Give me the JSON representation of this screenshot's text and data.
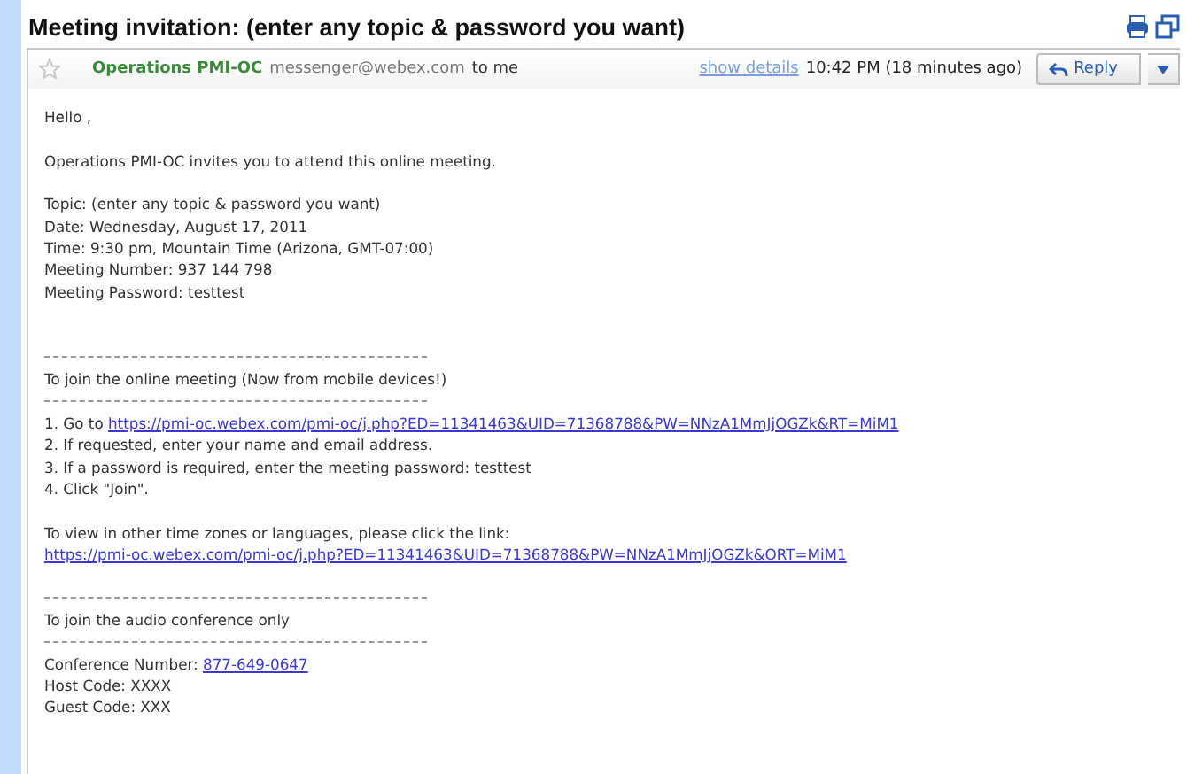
{
  "subject": "Meeting invitation: (enter any topic & password you want)",
  "header": {
    "starred": false,
    "sender": "Operations PMI-OC",
    "address": "messenger@webex.com",
    "to": "to me",
    "details_link": "show details",
    "time": "10:42 PM (18 minutes ago)",
    "reply": "Reply"
  },
  "body": [
    {
      "kind": "text",
      "text": "Hello ,"
    },
    {
      "kind": "blank"
    },
    {
      "kind": "text",
      "text": "Operations PMI-OC invites you to attend this online meeting."
    },
    {
      "kind": "blank"
    },
    {
      "kind": "text",
      "text": "Topic: (enter any topic & password you want)"
    },
    {
      "kind": "text",
      "text": "Date: Wednesday, August 17, 2011"
    },
    {
      "kind": "text",
      "text": "Time: 9:30 pm, Mountain Time (Arizona, GMT-07:00)"
    },
    {
      "kind": "text",
      "text": "Meeting Number: 937 144 798"
    },
    {
      "kind": "text",
      "text": "Meeting Password: testtest"
    },
    {
      "kind": "blank"
    },
    {
      "kind": "blank"
    },
    {
      "kind": "rule"
    },
    {
      "kind": "text",
      "text": "To join the online meeting (Now from mobile devices!)"
    },
    {
      "kind": "rule"
    },
    {
      "kind": "link",
      "text": "1. Go to ",
      "link": "https://pmi-oc.webex.com/pmi-oc/j.php?ED=11341463&UID=71368788&PW=NNzA1MmJjOGZk&RT=MiM1"
    },
    {
      "kind": "text",
      "text": "2. If requested, enter your name and email address."
    },
    {
      "kind": "text",
      "text": "3. If a password is required, enter the meeting password: testtest"
    },
    {
      "kind": "text",
      "text": "4. Click \"Join\"."
    },
    {
      "kind": "blank"
    },
    {
      "kind": "text",
      "text": "To view in other time zones or languages, please click the link:"
    },
    {
      "kind": "link",
      "link": "https://pmi-oc.webex.com/pmi-oc/j.php?ED=11341463&UID=71368788&PW=NNzA1MmJjOGZk&ORT=MiM1"
    },
    {
      "kind": "blank"
    },
    {
      "kind": "rule"
    },
    {
      "kind": "text",
      "text": "To join the audio conference only"
    },
    {
      "kind": "rule"
    },
    {
      "kind": "link",
      "text": "Conference Number: ",
      "link": "877-649-0647"
    },
    {
      "kind": "text",
      "text": "Host Code: XXXX"
    },
    {
      "kind": "text",
      "text": "Guest Code: XXX"
    }
  ]
}
